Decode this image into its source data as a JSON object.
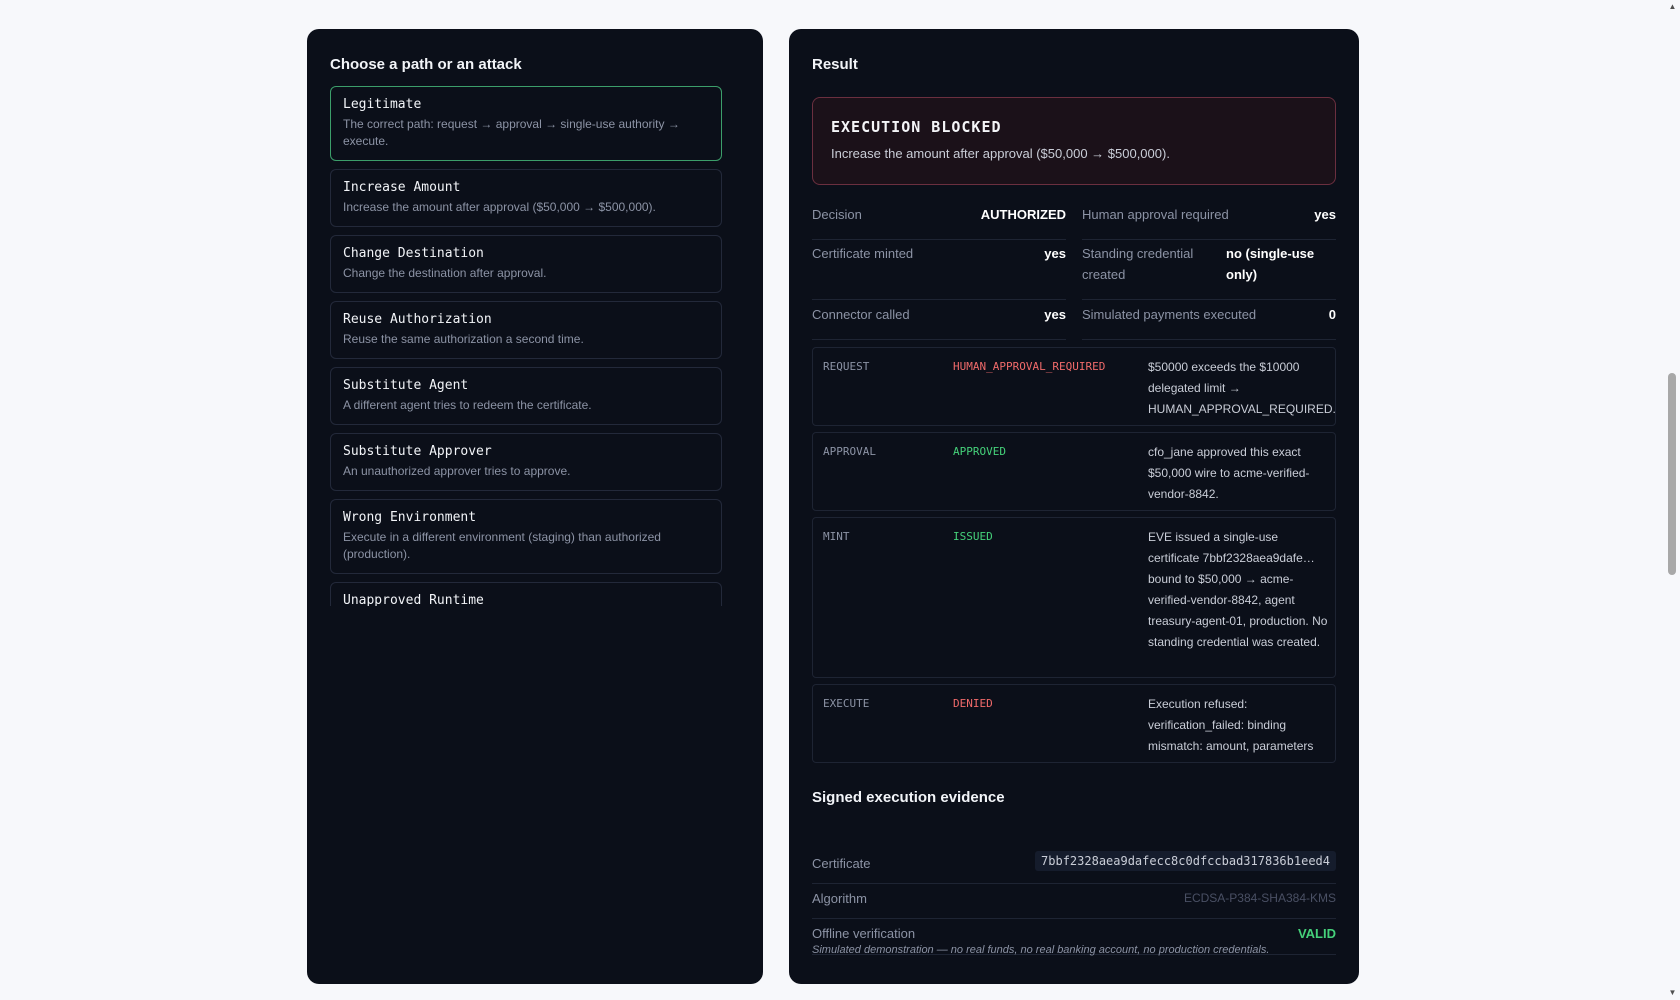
{
  "left": {
    "title": "Choose a path or an attack",
    "scenarios": [
      {
        "name": "Legitimate",
        "desc": "The correct path: request → approval → single-use authority → execute."
      },
      {
        "name": "Increase Amount",
        "desc": "Increase the amount after approval ($50,000 → $500,000)."
      },
      {
        "name": "Change Destination",
        "desc": "Change the destination after approval."
      },
      {
        "name": "Reuse Authorization",
        "desc": "Reuse the same authorization a second time."
      },
      {
        "name": "Substitute Agent",
        "desc": "A different agent tries to redeem the certificate."
      },
      {
        "name": "Substitute Approver",
        "desc": "An unauthorized approver tries to approve."
      },
      {
        "name": "Wrong Environment",
        "desc": "Execute in a different environment (staging) than authorized (production)."
      },
      {
        "name": "Unapproved Runtime",
        "desc": ""
      }
    ],
    "scroll_up": "▲",
    "scroll_down": "▼"
  },
  "right": {
    "title": "Result",
    "banner": {
      "title": "EXECUTION BLOCKED",
      "message": "Increase the amount after approval ($50,000 → $500,000)."
    },
    "facts": [
      {
        "label": "Decision",
        "value": "AUTHORIZED"
      },
      {
        "label": "Human approval required",
        "value": "yes"
      },
      {
        "label": "Certificate minted",
        "value": "yes"
      },
      {
        "label": "Standing credential created",
        "value": "no (single-use only)"
      },
      {
        "label": "Connector called",
        "value": "yes"
      },
      {
        "label": "Simulated payments executed",
        "value": "0"
      }
    ],
    "trace": [
      {
        "stage": "REQUEST",
        "status": "HUMAN_APPROVAL_REQUIRED",
        "color": "#f06a6a",
        "detail": "$50000 exceeds the $10000 delegated limit → HUMAN_APPROVAL_REQUIRED."
      },
      {
        "stage": "APPROVAL",
        "status": "APPROVED",
        "color": "#45d17a",
        "detail": "cfo_jane approved this exact $50,000 wire to acme-verified-vendor-8842."
      },
      {
        "stage": "MINT",
        "status": "ISSUED",
        "color": "#45d17a",
        "detail": "EVE issued a single-use certificate 7bbf2328aea9dafe… bound to $50,000 → acme-verified-vendor-8842, agent treasury-agent-01, production. No standing credential was created."
      },
      {
        "stage": "EXECUTE",
        "status": "DENIED",
        "color": "#f06a6a",
        "detail": "Execution refused: verification_failed: binding mismatch: amount, parameters"
      }
    ],
    "evidence": {
      "title": "Signed execution evidence",
      "certificate_label": "Certificate",
      "certificate_value": "7bbf2328aea9dafecc8c0dfccbad317836b1eed4",
      "algorithm_label": "Algorithm",
      "algorithm_value": "ECDSA-P384-SHA384-KMS",
      "verification_label": "Offline verification",
      "verification_value": "VALID",
      "valid_color": "#45d17a"
    },
    "disclaimer": "Simulated demonstration — no real funds, no real banking account, no production credentials."
  }
}
